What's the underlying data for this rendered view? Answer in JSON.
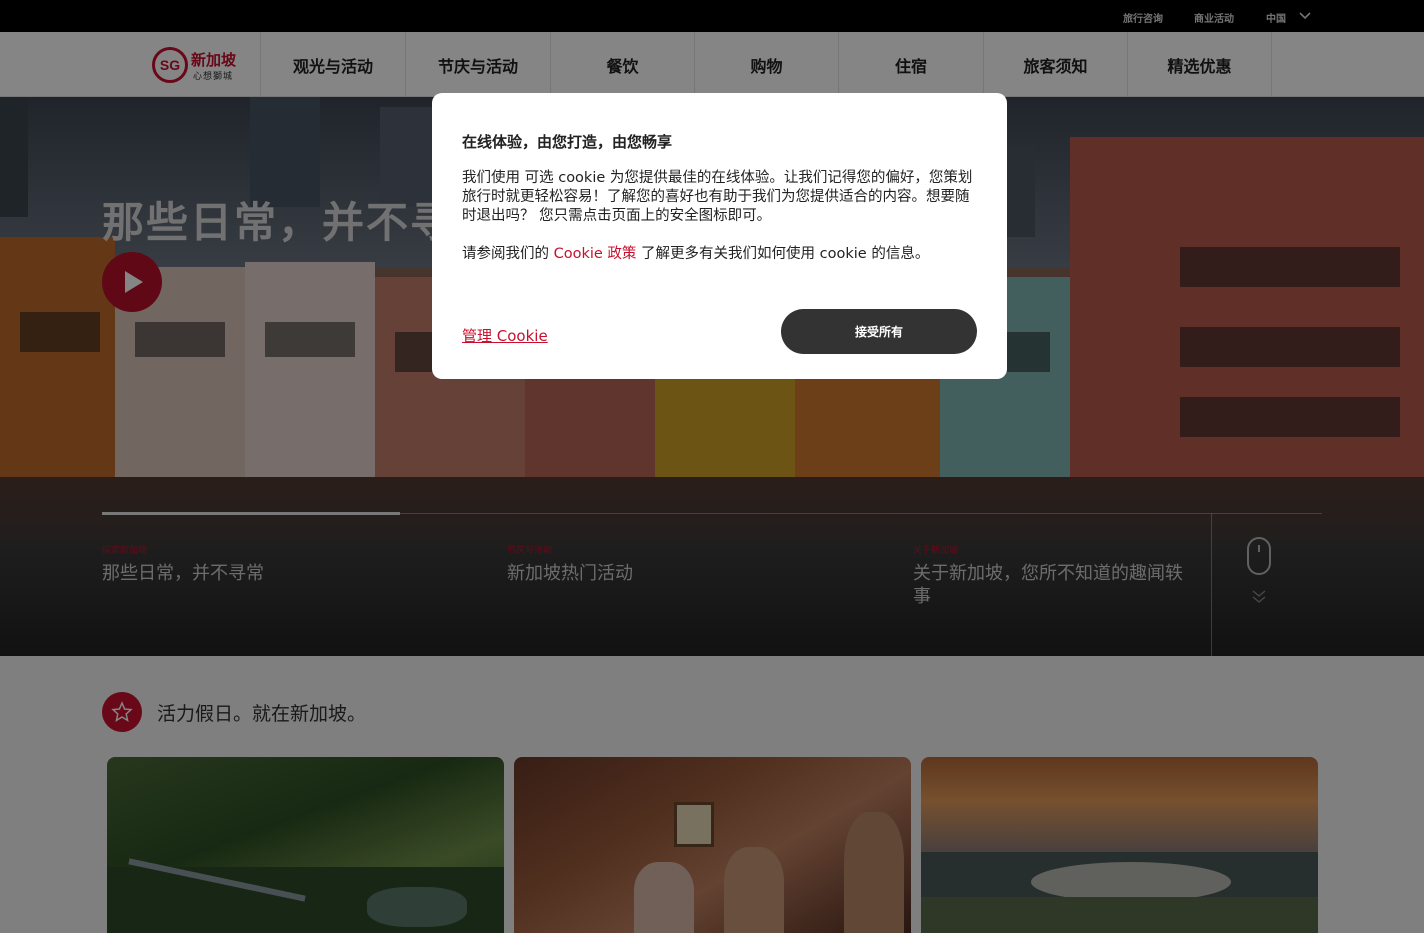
{
  "utility_bar": {
    "links": [
      "旅行咨询",
      "商业活动"
    ],
    "region": "中国"
  },
  "logo": {
    "mark": "SG",
    "name": "新加坡",
    "tagline": "心想獅城"
  },
  "nav": {
    "items": [
      "观光与活动",
      "节庆与活动",
      "餐饮",
      "购物",
      "住宿",
      "旅客须知",
      "精选优惠"
    ]
  },
  "hero": {
    "title": "那些日常，并不寻",
    "slides": [
      {
        "kicker": "探索新加坡",
        "title": "那些日常，并不寻常"
      },
      {
        "kicker": "节庆与活动",
        "title": "新加坡热门活动"
      },
      {
        "kicker": "关于新加坡",
        "title": "关于新加坡，您所不知道的趣闻轶事"
      }
    ]
  },
  "section": {
    "heading": "活力假日。就在新加坡。"
  },
  "cookie_modal": {
    "title": "在线体验，由您打造，由您畅享",
    "body": "我们使用 可选 cookie 为您提供最佳的在线体验。让我们记得您的偏好，您策划旅行时就更轻松容易！了解您的喜好也有助于我们为您提供适合的内容。想要随时退出吗？ 您只需点击页面上的安全图标即可。",
    "policy_prefix": "请参阅我们的 ",
    "policy_link": "Cookie 政策",
    "policy_suffix": " 了解更多有关我们如何使用 cookie 的信息。",
    "manage_label": "管理 Cookie",
    "accept_label": "接受所有"
  },
  "colors": {
    "brand_red": "#c8102e",
    "accept_button": "#333333"
  }
}
